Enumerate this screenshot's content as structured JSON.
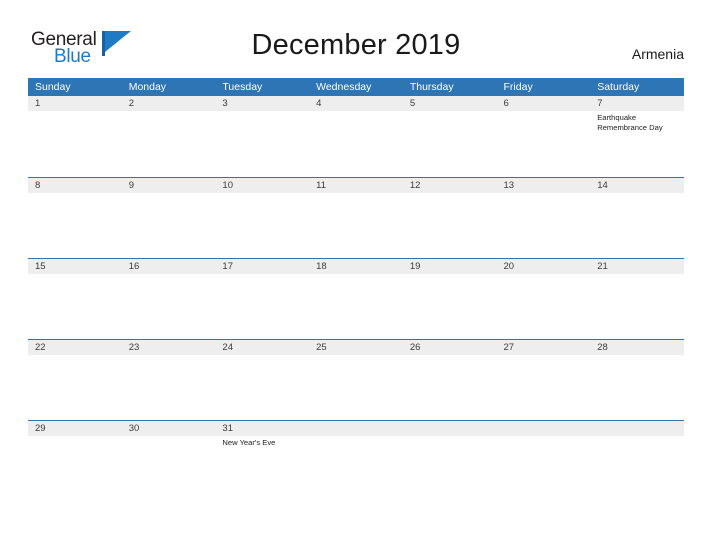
{
  "brand": {
    "name_part1": "General",
    "name_part2": "Blue",
    "accent_color": "#1e7bc4",
    "logo_icon": "triangle-flag-icon"
  },
  "header": {
    "title": "December 2019",
    "country": "Armenia"
  },
  "theme": {
    "header_blue": "#2e75b6",
    "date_strip_gray": "#eeeeee",
    "text_dark": "#1a1a1a"
  },
  "calendar": {
    "month": "December",
    "year": "2019",
    "weekday_headers": [
      "Sunday",
      "Monday",
      "Tuesday",
      "Wednesday",
      "Thursday",
      "Friday",
      "Saturday"
    ],
    "weeks": [
      {
        "days": [
          {
            "date": "1",
            "events": []
          },
          {
            "date": "2",
            "events": []
          },
          {
            "date": "3",
            "events": []
          },
          {
            "date": "4",
            "events": []
          },
          {
            "date": "5",
            "events": []
          },
          {
            "date": "6",
            "events": []
          },
          {
            "date": "7",
            "events": [
              "Earthquake Remembrance Day"
            ]
          }
        ]
      },
      {
        "days": [
          {
            "date": "8",
            "events": []
          },
          {
            "date": "9",
            "events": []
          },
          {
            "date": "10",
            "events": []
          },
          {
            "date": "11",
            "events": []
          },
          {
            "date": "12",
            "events": []
          },
          {
            "date": "13",
            "events": []
          },
          {
            "date": "14",
            "events": []
          }
        ]
      },
      {
        "days": [
          {
            "date": "15",
            "events": []
          },
          {
            "date": "16",
            "events": []
          },
          {
            "date": "17",
            "events": []
          },
          {
            "date": "18",
            "events": []
          },
          {
            "date": "19",
            "events": []
          },
          {
            "date": "20",
            "events": []
          },
          {
            "date": "21",
            "events": []
          }
        ]
      },
      {
        "days": [
          {
            "date": "22",
            "events": []
          },
          {
            "date": "23",
            "events": []
          },
          {
            "date": "24",
            "events": []
          },
          {
            "date": "25",
            "events": []
          },
          {
            "date": "26",
            "events": []
          },
          {
            "date": "27",
            "events": []
          },
          {
            "date": "28",
            "events": []
          }
        ]
      },
      {
        "days": [
          {
            "date": "29",
            "events": []
          },
          {
            "date": "30",
            "events": []
          },
          {
            "date": "31",
            "events": [
              "New Year's Eve"
            ]
          },
          {
            "date": "",
            "events": []
          },
          {
            "date": "",
            "events": []
          },
          {
            "date": "",
            "events": []
          },
          {
            "date": "",
            "events": []
          }
        ]
      }
    ]
  }
}
